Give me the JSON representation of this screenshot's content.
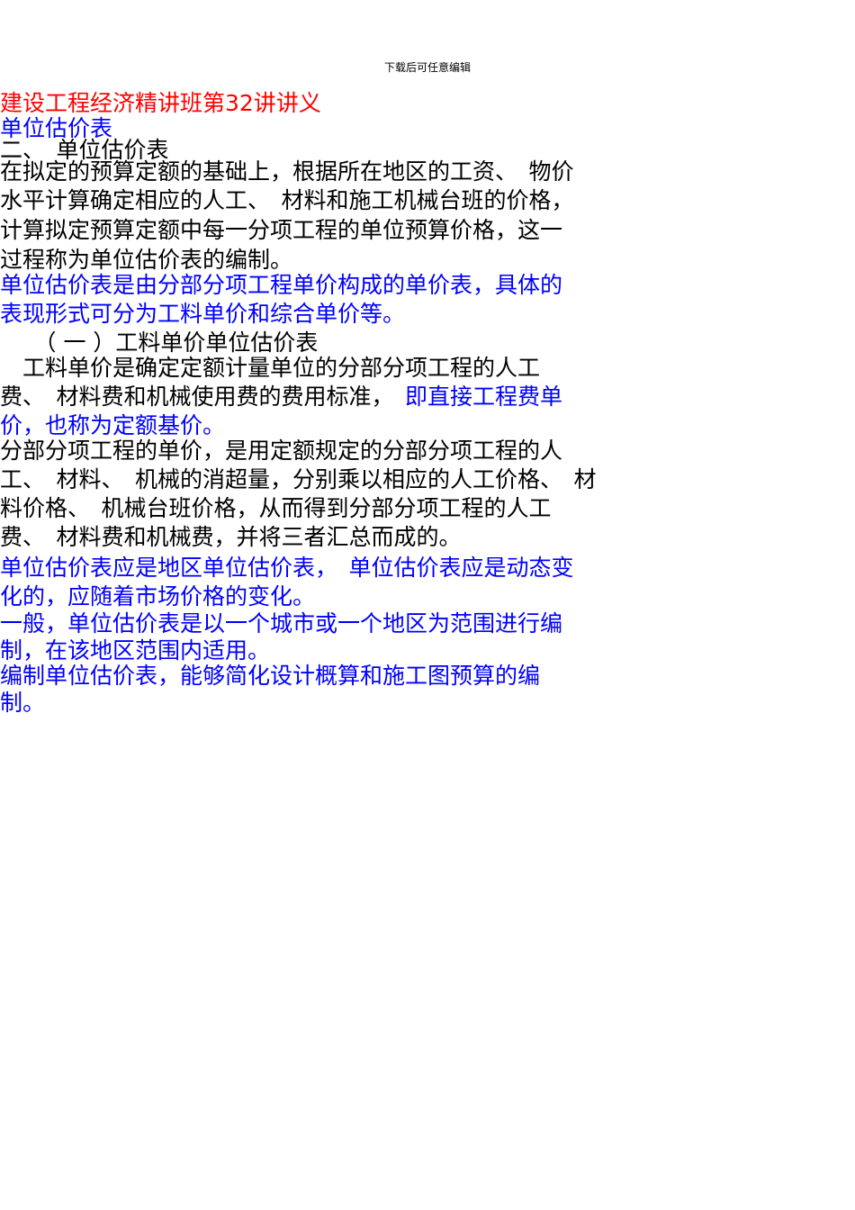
{
  "header_note": "下载后可任意编辑",
  "colors": {
    "title": "#ff0000",
    "body": "#000000",
    "emphasis": "#0000ff"
  },
  "lines": [
    {
      "text": "建设工程经济精讲班第32讲讲义",
      "color": "red"
    },
    {
      "text": "单位估价表",
      "color": "blue"
    },
    {
      "text": "二、　单位估价表",
      "color": "black"
    },
    {
      "text": "在拟定的预算定额的基础上，根据所在地区的工资、　物价",
      "color": "black"
    },
    {
      "text": "水平计算确定相应的人工、　材料和施工机械台班的价格，",
      "color": "black"
    },
    {
      "text": "计算拟定预算定额中每一分项工程的单位预算价格，这一",
      "color": "black"
    },
    {
      "text": "过程称为单位估价表的编制。",
      "color": "black"
    },
    {
      "text": "单位估价表是由分部分项工程单价构成的单价表，具体的",
      "color": "blue"
    },
    {
      "text": "表现形式可分为工料单价和综合单价等。",
      "color": "blue"
    },
    {
      "text": "　　（ 一 ）工料单价单位估价表",
      "color": "black"
    },
    {
      "text": "　工料单价是确定定额计量单位的分部分项工程的人工",
      "color": "black"
    },
    {
      "text": "费、　材料费和机械使用费的费用标准，",
      "color": "black",
      "tail": "　即直接工程费单",
      "tail_color": "blue"
    },
    {
      "text": "价，也称为定额基价。",
      "color": "blue"
    },
    {
      "text": "分部分项工程的单价，是用定额规定的分部分项工程的人",
      "color": "black"
    },
    {
      "text": "工、　材料、　机械的消超量，分别乘以相应的人工价格、　材",
      "color": "black"
    },
    {
      "text": "料价格、　机械台班价格，从而得到分部分项工程的人工",
      "color": "black"
    },
    {
      "text": "费、　材料费和机械费，并将三者汇总而成的。",
      "color": "black"
    },
    {
      "text": "单位估价表应是地区单位估价表，　单位估价表应是动态变",
      "color": "blue"
    },
    {
      "text": "化的，应随着市场价格的变化。",
      "color": "blue"
    },
    {
      "text": "一般，单位估价表是以一个城市或一个地区为范围进行编",
      "color": "blue"
    },
    {
      "text": "制，在该地区范围内适用。",
      "color": "blue"
    },
    {
      "text": "编制单位估价表，能够简化设计概算和施工图预算的编",
      "color": "blue"
    },
    {
      "text": "制。",
      "color": "blue"
    }
  ]
}
